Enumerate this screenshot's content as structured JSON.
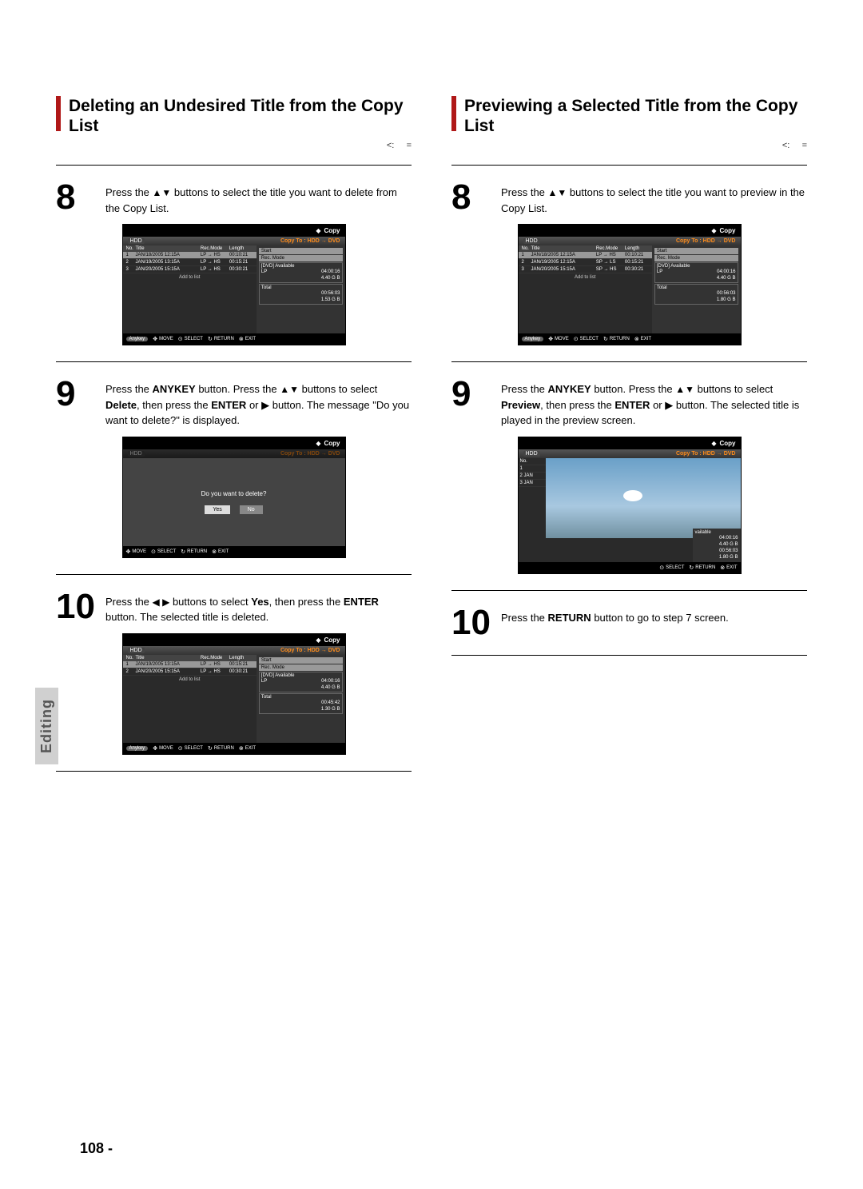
{
  "left": {
    "heading": "Deleting an Undesired Title from the Copy List",
    "sub": "<:     =",
    "step8": {
      "num": "8",
      "text_a": "Press the ",
      "arrows": "▲▼",
      "text_b": " buttons to select the title you want to delete from the Copy List."
    },
    "screen1": {
      "copy": "Copy",
      "hdd": "HDD",
      "copyto": "Copy To : HDD → DVD",
      "cols": {
        "no": "No.",
        "title": "Title",
        "rec": "Rec.Mode",
        "len": "Length"
      },
      "rows": [
        {
          "no": "1",
          "title": "JAN/18/2005 12:15A",
          "rec": "LP → HS",
          "len": "00:10:21",
          "sel": true
        },
        {
          "no": "2",
          "title": "JAN/19/2005 13:15A",
          "rec": "LP → HS",
          "len": "00:15:21"
        },
        {
          "no": "3",
          "title": "JAN/20/2005 15:15A",
          "rec": "LP → HS",
          "len": "00:30:21"
        }
      ],
      "add": "Add to list",
      "side": {
        "start": "Start",
        "recmode": "Rec. Mode",
        "dvd": "[DVD] Available",
        "lp": "LP",
        "lptime": "04:00:16",
        "lpsize": "4.40 G B",
        "total": "Total",
        "ttime": "00:56:03",
        "tsize": "1.53 G B"
      },
      "footer": {
        "anykey": "Anykey",
        "move": "MOVE",
        "select": "SELECT",
        "return": "RETURN",
        "exit": "EXIT"
      }
    },
    "step9": {
      "num": "9",
      "a": "Press the ",
      "anykey": "ANYKEY",
      "b": " button. Press the ",
      "arrows": "▲▼",
      "c": " buttons to select ",
      "delete": "Delete",
      "d": ", then press the ",
      "enter": "ENTER",
      "e": " or ",
      "rt": "▶",
      "f": " button. The message ",
      "q1": "\"",
      "msg": "Do you want to delete?",
      "q2": "\"",
      "g": " is displayed."
    },
    "screen2": {
      "copy": "Copy",
      "hdd": "HDD",
      "copyto": "Copy To : HDD → DVD",
      "msg": "Do you want to delete?",
      "yes": "Yes",
      "no": "No",
      "footer": {
        "move": "MOVE",
        "select": "SELECT",
        "return": "RETURN",
        "exit": "EXIT"
      }
    },
    "step10": {
      "num": "10",
      "a": "Press the ",
      "arrows": "◀ ▶",
      "b": " buttons to select ",
      "yes": "Yes",
      "c": ", then press the ",
      "enter": "ENTER",
      "d": " button.  The selected title is deleted."
    },
    "screen3": {
      "copy": "Copy",
      "hdd": "HDD",
      "copyto": "Copy To : HDD → DVD",
      "cols": {
        "no": "No.",
        "title": "Title",
        "rec": "Rec.Mode",
        "len": "Length"
      },
      "rows": [
        {
          "no": "1",
          "title": "JAN/19/2005 13:15A",
          "rec": "LP → HS",
          "len": "00:15:21",
          "sel": true
        },
        {
          "no": "2",
          "title": "JAN/20/2005 15:15A",
          "rec": "LP → HS",
          "len": "00:30:21"
        }
      ],
      "add": "Add to list",
      "side": {
        "start": "Start",
        "recmode": "Rec. Mode",
        "dvd": "[DVD] Available",
        "lp": "LP",
        "lptime": "04:00:16",
        "lpsize": "4.40 G B",
        "total": "Total",
        "ttime": "00:45:42",
        "tsize": "1.30 G B"
      },
      "footer": {
        "anykey": "Anykey",
        "move": "MOVE",
        "select": "SELECT",
        "return": "RETURN",
        "exit": "EXIT"
      }
    }
  },
  "right": {
    "heading": "Previewing a Selected Title from the Copy List",
    "sub": "<:     =",
    "step8": {
      "num": "8",
      "a": "Press the ",
      "arrows": "▲▼",
      "b": " buttons to select the title you want to preview in the Copy List."
    },
    "screen1": {
      "copy": "Copy",
      "hdd": "HDD",
      "copyto": "Copy To : HDD → DVD",
      "cols": {
        "no": "No.",
        "title": "Title",
        "rec": "Rec.Mode",
        "len": "Length"
      },
      "rows": [
        {
          "no": "1",
          "title": "JAN/18/2005 12:15A",
          "rec": "LP → HS",
          "len": "00:10:21",
          "sel": true
        },
        {
          "no": "2",
          "title": "JAN/19/2005 12:15A",
          "rec": "SP → LS",
          "len": "00:15:21"
        },
        {
          "no": "3",
          "title": "JAN/20/2005 15:15A",
          "rec": "SP → HS",
          "len": "00:30:21"
        }
      ],
      "add": "Add to list",
      "side": {
        "start": "Start",
        "recmode": "Rec. Mode",
        "dvd": "[DVD] Available",
        "lp": "LP",
        "lptime": "04:00:16",
        "lpsize": "4.40 G B",
        "total": "Total",
        "ttime": "00:56:03",
        "tsize": "1.80 G B"
      },
      "footer": {
        "anykey": "Anykey",
        "move": "MOVE",
        "select": "SELECT",
        "return": "RETURN",
        "exit": "EXIT"
      }
    },
    "step9": {
      "num": "9",
      "a": "Press the ",
      "anykey": "ANYKEY",
      "b": " button. Press the ",
      "arrows": "▲▼",
      "c": " buttons to select ",
      "preview": "Preview",
      "d": ", then press the ",
      "enter": "ENTER",
      "e": " or ",
      "rt": "▶",
      "f": " button.  The selected title is played in the preview screen."
    },
    "screen2": {
      "copy": "Copy",
      "hdd": "HDD",
      "copyto": "Copy To : HDD → DVD",
      "cols": {
        "no": "No."
      },
      "rows": [
        {
          "no": "1"
        },
        {
          "no": "2",
          "t": "JAN"
        },
        {
          "no": "3",
          "t": "JAN"
        }
      ],
      "side": {
        "avail": "vailable",
        "t1": "04:00:16",
        "s1": "4.40 G B",
        "t2": "00:56:03",
        "s2": "1.80 G B"
      },
      "footer": {
        "select": "SELECT",
        "return": "RETURN",
        "exit": "EXIT"
      }
    },
    "step10": {
      "num": "10",
      "a": "Press the ",
      "return": "RETURN",
      "b": " button to go to step 7 screen."
    }
  },
  "sidetab": "Editing",
  "pagenum": "108 -",
  "glyph": {
    "diamond": "◆",
    "disc": "⊙",
    "ret": "↻",
    "x": "⊗",
    "udlr": "✥"
  }
}
